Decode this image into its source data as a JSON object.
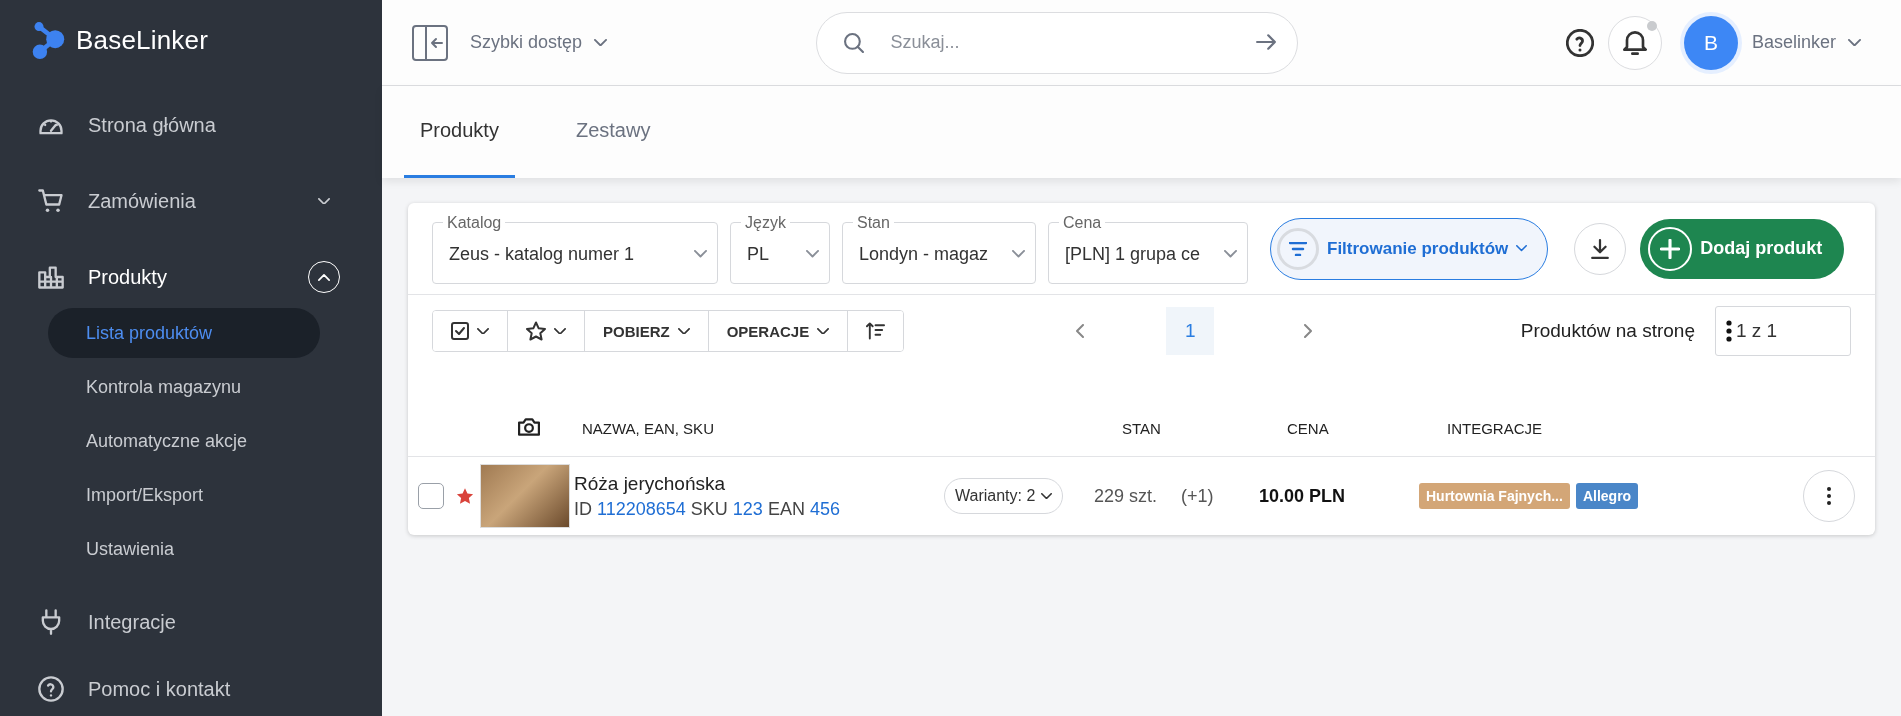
{
  "brand": {
    "name": "BaseLinker"
  },
  "sidebar": {
    "items": [
      {
        "label": "Strona główna"
      },
      {
        "label": "Zamówienia",
        "expanded": false
      },
      {
        "label": "Produkty",
        "expanded": true,
        "children": [
          {
            "label": "Lista produktów",
            "selected": true
          },
          {
            "label": "Kontrola magazynu",
            "selected": false
          },
          {
            "label": "Automatyczne akcje",
            "selected": false
          },
          {
            "label": "Import/Eksport",
            "selected": false
          },
          {
            "label": "Ustawienia",
            "selected": false
          }
        ]
      },
      {
        "label": "Integracje"
      },
      {
        "label": "Pomoc i kontakt"
      }
    ]
  },
  "topbar": {
    "quick_access": "Szybki dostęp",
    "search": {
      "placeholder": "Szukaj..."
    },
    "notifications_unread": true,
    "user": {
      "initial": "B",
      "name": "Baselinker"
    }
  },
  "tabs": [
    {
      "label": "Produkty",
      "selected": true
    },
    {
      "label": "Zestawy",
      "selected": false
    }
  ],
  "filters": [
    {
      "label": "Katalog",
      "value": "Zeus - katalog numer 1"
    },
    {
      "label": "Język",
      "value": "PL"
    },
    {
      "label": "Stan",
      "value": "Londyn - magaz"
    },
    {
      "label": "Cena",
      "value": "[PLN] 1 grupa ce"
    }
  ],
  "filter_button": "Filtrowanie produktów",
  "add_button": "Dodaj produkt",
  "toolbar": {
    "buttons": [
      "POBIERZ",
      "OPERACJE"
    ]
  },
  "pagination": {
    "pages": [
      {
        "label": "1",
        "selected": true
      }
    ],
    "per_page_label": "Produktów na stronę",
    "per_page_value": "1 z 1"
  },
  "table": {
    "columns": [
      "NAZWA, EAN, SKU",
      "STAN",
      "CENA",
      "INTEGRACJE"
    ],
    "rows": [
      {
        "checked": false,
        "starred": true,
        "name": "Róża jerychońska",
        "id_label": "ID",
        "id": "112208654",
        "sku_label": "SKU",
        "sku": "123",
        "ean_label": "EAN",
        "ean": "456",
        "variants": "Warianty: 2",
        "stock": "229 szt.",
        "stock_change": "(+1)",
        "price": "10.00 PLN",
        "integrations": [
          {
            "label": "Hurtownia Fajnych...",
            "color": "#d3a677"
          },
          {
            "label": "Allegro",
            "color": "#4a86c8"
          }
        ]
      }
    ]
  }
}
